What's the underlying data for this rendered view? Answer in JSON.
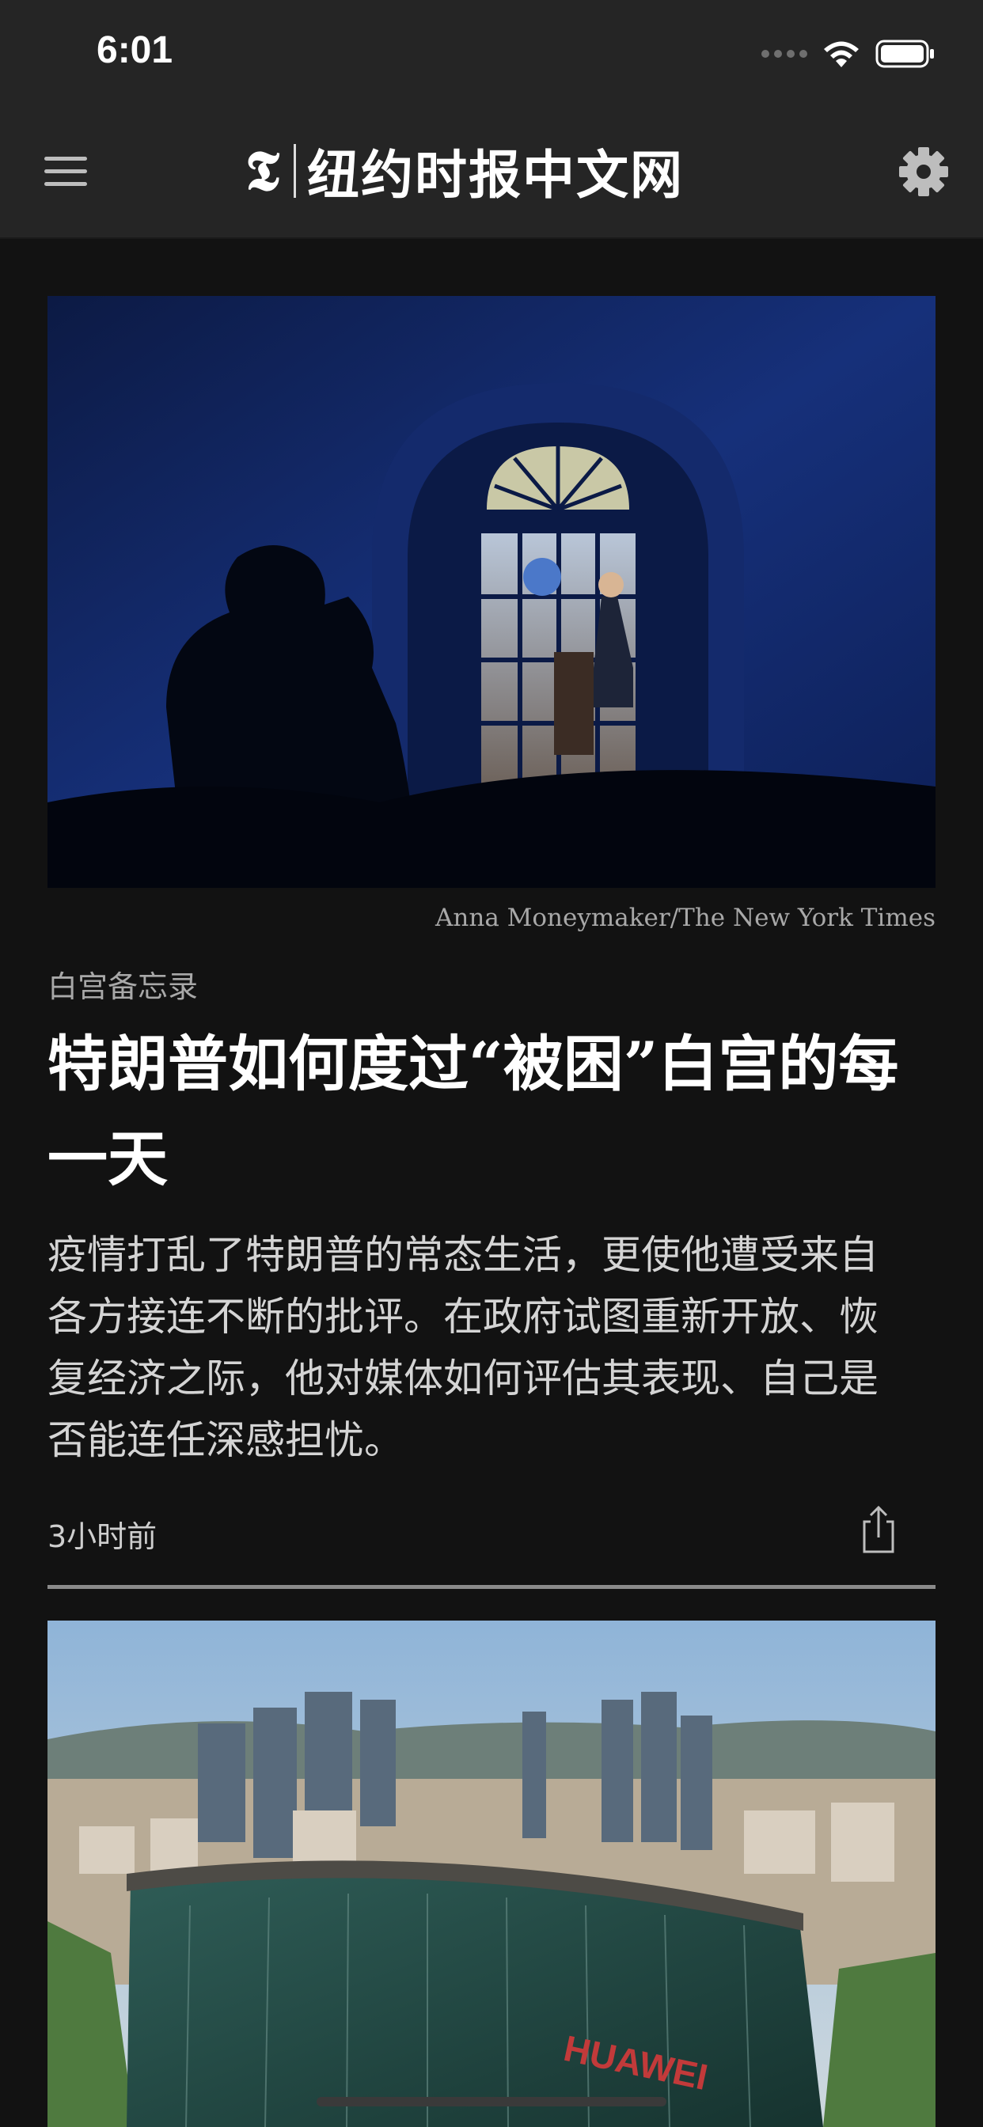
{
  "status_bar": {
    "time": "6:01"
  },
  "nav": {
    "logo_glyph": "𝕿",
    "title": "纽约时报中文网",
    "menu_icon": "hamburger-icon",
    "settings_icon": "gear-icon"
  },
  "article": {
    "image_credit": "Anna Moneymaker/The New York Times",
    "kicker": "白宫备忘录",
    "headline": "特朗普如何度过“被困”白宫的每一天",
    "summary": "疫情打乱了特朗普的常态生活，更使他遭受来自各方接连不断的批评。在政府试图重新开放、恢复经济之际，他对媒体如何评估其表现、自己是否能连任深感担忧。",
    "timestamp": "3小时前",
    "share_icon": "share-icon"
  },
  "next_article": {
    "image_sign_text": "HUAWEI"
  },
  "colors": {
    "background": "#121212",
    "bar": "#252525",
    "headline": "#ffffff",
    "secondary": "#a8a8a8"
  }
}
